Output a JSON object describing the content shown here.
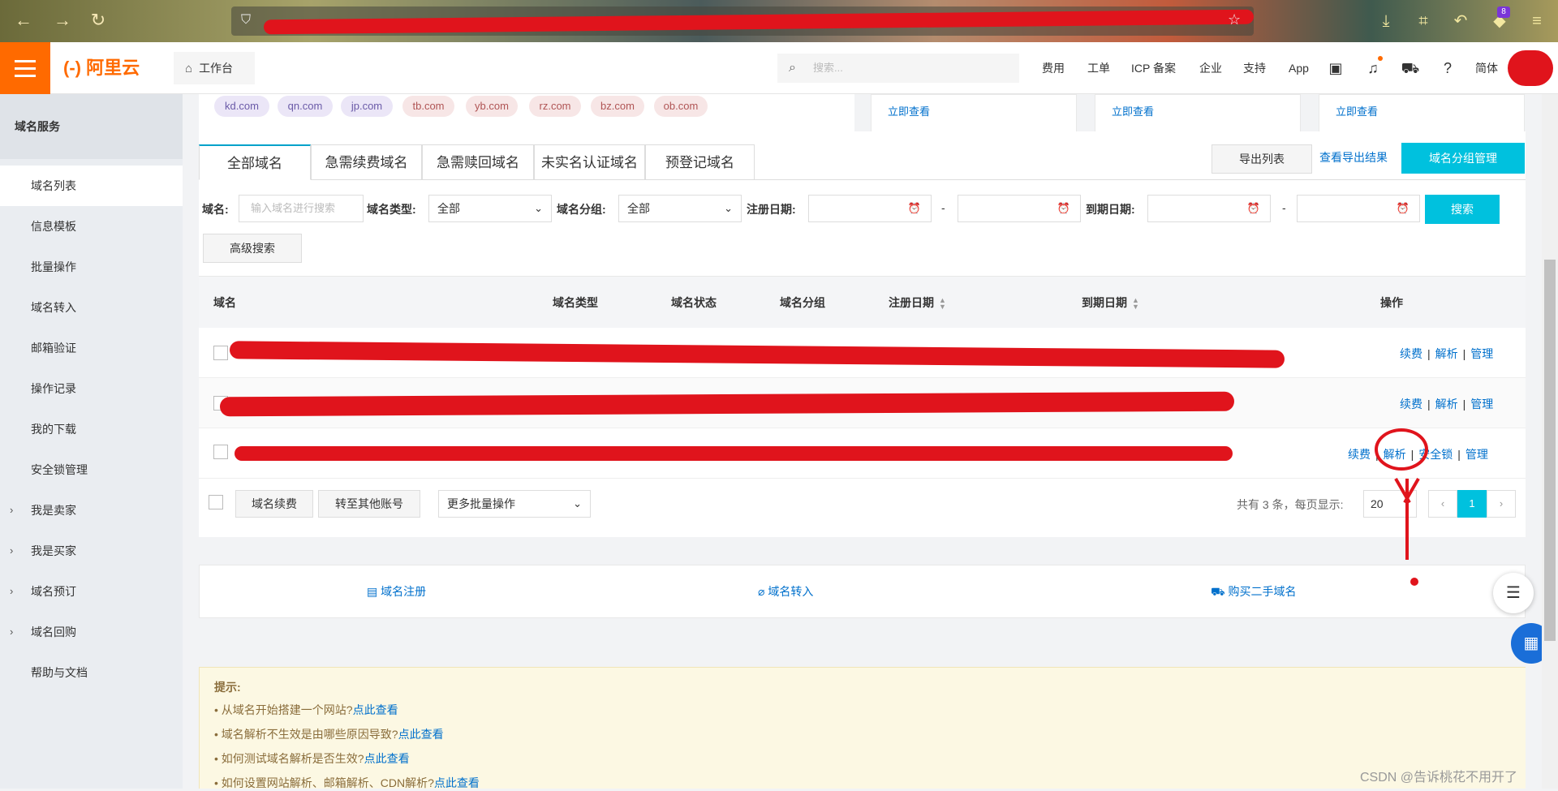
{
  "browser": {
    "badge_count": "8"
  },
  "header": {
    "logo": "(-) 阿里云",
    "workbench": "工作台",
    "search_placeholder": "搜索...",
    "nav": [
      "费用",
      "工单",
      "ICP 备案",
      "企业",
      "支持",
      "App"
    ],
    "language": "简体"
  },
  "sidebar": {
    "title": "域名服务",
    "items": [
      {
        "label": "域名列表"
      },
      {
        "label": "信息模板"
      },
      {
        "label": "批量操作"
      },
      {
        "label": "域名转入"
      },
      {
        "label": "邮箱验证"
      },
      {
        "label": "操作记录"
      },
      {
        "label": "我的下载"
      },
      {
        "label": "安全锁管理"
      },
      {
        "label": "我是卖家"
      },
      {
        "label": "我是买家"
      },
      {
        "label": "域名预订"
      },
      {
        "label": "域名回购"
      },
      {
        "label": "帮助与文档"
      }
    ]
  },
  "domain_tags": [
    "kd.com",
    "qn.com",
    "jp.com",
    "tb.com",
    "yb.com",
    "rz.com",
    "bz.com",
    "ob.com"
  ],
  "promo_links": [
    "立即查看",
    "立即查看",
    "立即查看"
  ],
  "tabs": [
    "全部域名",
    "急需续费域名",
    "急需赎回域名",
    "未实名认证域名",
    "预登记域名"
  ],
  "toolbar": {
    "export_list": "导出列表",
    "view_export": "查看导出结果",
    "group_manage": "域名分组管理"
  },
  "filters": {
    "domain_label": "域名:",
    "domain_placeholder": "输入域名进行搜索",
    "type_label": "域名类型:",
    "type_value": "全部",
    "group_label": "域名分组:",
    "group_value": "全部",
    "reg_date_label": "注册日期:",
    "exp_date_label": "到期日期:",
    "dash": "-",
    "search_btn": "搜索",
    "advanced_btn": "高级搜索"
  },
  "table": {
    "headers": [
      "域名",
      "域名类型",
      "域名状态",
      "域名分组",
      "注册日期",
      "到期日期",
      "操作"
    ],
    "rows": [
      {
        "ops": [
          "续费",
          "解析",
          "管理"
        ]
      },
      {
        "ops": [
          "续费",
          "解析",
          "管理"
        ]
      },
      {
        "ops": [
          "续费",
          "解析",
          "安全锁",
          "管理"
        ]
      }
    ],
    "sep": "|"
  },
  "batch": {
    "renew_btn": "域名续费",
    "transfer_btn": "转至其他账号",
    "more_ops": "更多批量操作"
  },
  "pagination": {
    "total_text": "共有 3 条，每页显示:",
    "page_size": "20",
    "current_page": "1"
  },
  "quick_links": [
    "域名注册",
    "域名转入",
    "购买二手域名"
  ],
  "tips": {
    "title": "提示:",
    "items": [
      {
        "text": "• 从域名开始搭建一个网站?",
        "link": "点此查看"
      },
      {
        "text": "• 域名解析不生效是由哪些原因导致?",
        "link": "点此查看"
      },
      {
        "text": "• 如何测试域名解析是否生效?",
        "link": "点此查看"
      },
      {
        "text": "• 如何设置网站解析、邮箱解析、CDN解析?",
        "link": "点此查看"
      }
    ]
  },
  "watermark": "CSDN @告诉桃花不用开了"
}
